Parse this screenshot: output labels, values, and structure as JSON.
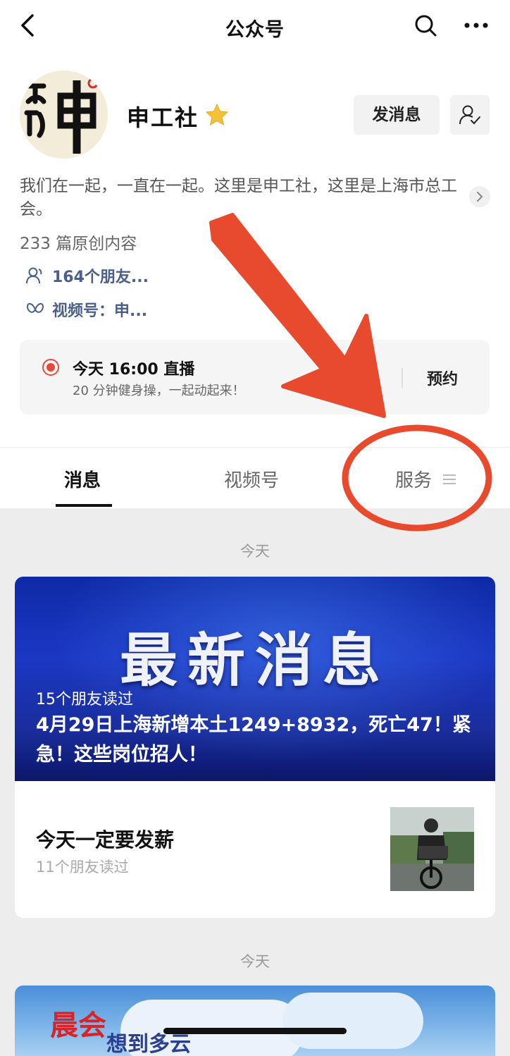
{
  "nav": {
    "title": "公众号"
  },
  "profile": {
    "name": "申工社",
    "follow_button": "发消息",
    "description": "我们在一起，一直在一起。这里是申工社，这里是上海市总工会。",
    "original_count": "233 篇原创内容",
    "friends_following": "164个朋友...",
    "channels": "视频号：申..."
  },
  "live": {
    "title": "今天 16:00 直播",
    "subtitle": "20 分钟健身操，一起动起来！",
    "action": "预约"
  },
  "tabs": [
    {
      "label": "消息",
      "active": true
    },
    {
      "label": "视频号",
      "active": false
    },
    {
      "label": "服务",
      "active": false
    }
  ],
  "feed": {
    "date1": "今天",
    "banner_headline": "最新消息",
    "banner_friends": "15个朋友读过",
    "banner_title": "4月29日上海新增本土1249+8932，死亡47！紧急！这些岗位招人！",
    "sub_title": "今天一定要发薪",
    "sub_friends": "11个朋友读过",
    "date2": "今天",
    "card2_red": "晨会",
    "card2_blue": "想到多云"
  },
  "colors": {
    "annotation_red": "#e84a2e",
    "banner_blue": "#1b38c4"
  }
}
